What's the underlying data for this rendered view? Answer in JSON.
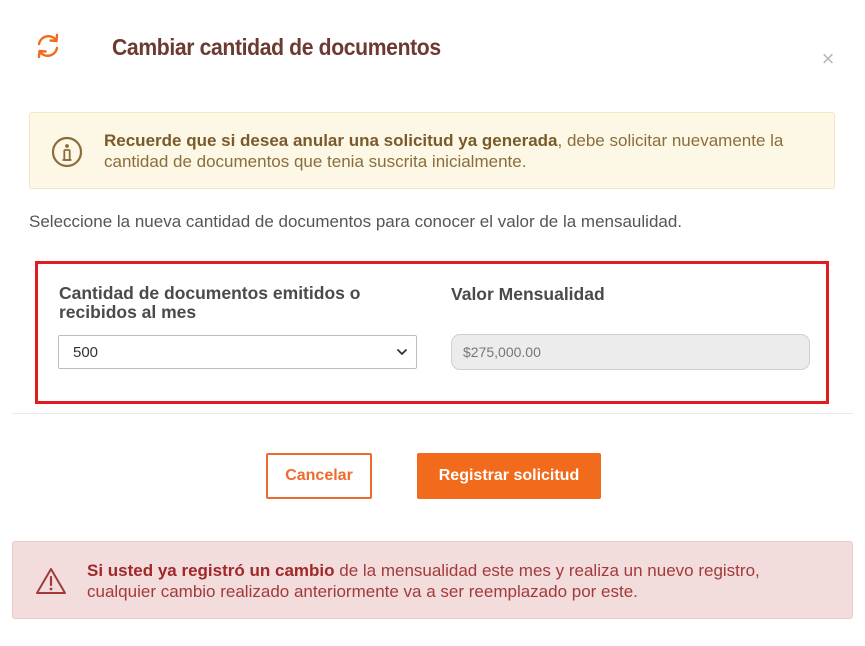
{
  "dialog": {
    "title": "Cambiar cantidad de documentos",
    "refresh_icon": "refresh-icon",
    "close_label": "×"
  },
  "info": {
    "icon": "info-icon",
    "bold_text": "Recuerde que si desea anular una solicitud ya generada",
    "text": ", debe solicitar nuevamente la cantidad de documentos que tenia suscrita inicialmente."
  },
  "intro": "Seleccione la nueva cantidad de documentos para conocer el valor de la mensaulidad.",
  "form": {
    "quantity_label": "Cantidad de documentos emitidos o recibidos al mes",
    "quantity_value": "500",
    "monthly_label": "Valor Mensualidad",
    "monthly_value": "$275,000.00"
  },
  "actions": {
    "cancel_label": "Cancelar",
    "register_label": "Registrar solicitud"
  },
  "warning": {
    "icon": "warning-icon",
    "bold_text": "Si usted ya registró un cambio",
    "text": " de la mensualidad este mes y realiza un nuevo registro, cualquier cambio realizado anteriormente va a ser reemplazado por este."
  },
  "colors": {
    "accent": "#f26a1b",
    "title": "#6b3a30",
    "highlight_border": "#e01b22"
  }
}
